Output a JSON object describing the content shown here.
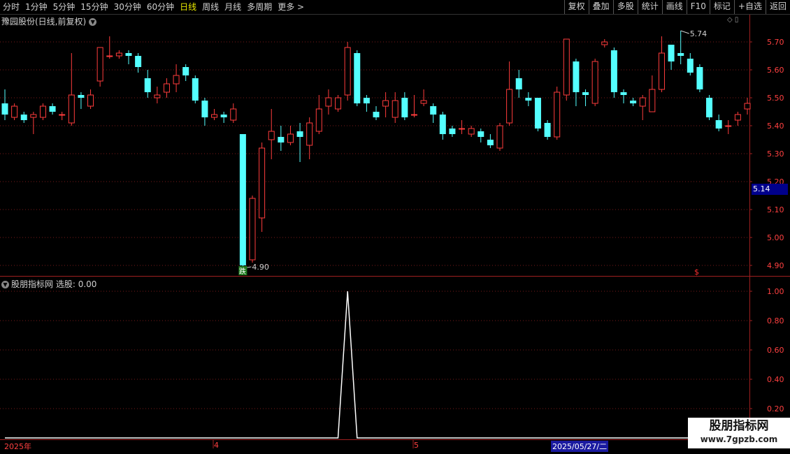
{
  "toolbar": {
    "period_tabs": [
      "分时",
      "1分钟",
      "5分钟",
      "15分钟",
      "30分钟",
      "60分钟",
      "日线",
      "周线",
      "月线",
      "多周期",
      "更多 >"
    ],
    "active_tab": "日线",
    "tools": [
      "复权",
      "叠加",
      "多股",
      "统计",
      "画线",
      "F10",
      "标记",
      "+自选",
      "返回"
    ]
  },
  "main_chart": {
    "title": "豫园股份(日线,前复权)",
    "current_price": "5.14",
    "price_ticks": [
      "5.70",
      "5.60",
      "5.50",
      "5.40",
      "5.30",
      "5.20",
      "5.10",
      "5.00",
      "4.90"
    ],
    "high_label": "5.74",
    "low_label": "4.90",
    "drop_marker": "跌",
    "s_marker": "$",
    "colors": {
      "up": "#ff3c3c",
      "down": "#54ffff",
      "grid": "#7a1a1a",
      "axis": "#a02020"
    }
  },
  "indicator": {
    "title": "股朋指标网",
    "value_label": "选股: 0.00",
    "ticks": [
      "1.00",
      "0.80",
      "0.60",
      "0.40",
      "0.20"
    ]
  },
  "date_axis": {
    "labels": [
      "2025年",
      "4",
      "5"
    ],
    "selected": "2025/05/27/二"
  },
  "watermark": {
    "title": "股朋指标网",
    "url": "www.7gpzb.com"
  },
  "chart_data": {
    "type": "candlestick",
    "ylim": [
      4.87,
      5.76
    ],
    "candles": [
      [
        5.48,
        5.44,
        5.53,
        5.42
      ],
      [
        5.43,
        5.47,
        5.48,
        5.42
      ],
      [
        5.44,
        5.42,
        5.45,
        5.41
      ],
      [
        5.43,
        5.44,
        5.45,
        5.37
      ],
      [
        5.43,
        5.47,
        5.48,
        5.42
      ],
      [
        5.47,
        5.45,
        5.48,
        5.44
      ],
      [
        5.44,
        5.44,
        5.45,
        5.42
      ],
      [
        5.41,
        5.51,
        5.66,
        5.4
      ],
      [
        5.51,
        5.5,
        5.52,
        5.46
      ],
      [
        5.47,
        5.51,
        5.53,
        5.46
      ],
      [
        5.56,
        5.68,
        5.68,
        5.54
      ],
      [
        5.65,
        5.65,
        5.72,
        5.64
      ],
      [
        5.65,
        5.66,
        5.67,
        5.64
      ],
      [
        5.66,
        5.65,
        5.67,
        5.62
      ],
      [
        5.65,
        5.61,
        5.66,
        5.59
      ],
      [
        5.57,
        5.52,
        5.6,
        5.5
      ],
      [
        5.5,
        5.51,
        5.54,
        5.48
      ],
      [
        5.52,
        5.55,
        5.57,
        5.5
      ],
      [
        5.55,
        5.58,
        5.62,
        5.52
      ],
      [
        5.61,
        5.58,
        5.62,
        5.56
      ],
      [
        5.57,
        5.49,
        5.58,
        5.48
      ],
      [
        5.49,
        5.43,
        5.5,
        5.4
      ],
      [
        5.43,
        5.44,
        5.46,
        5.42
      ],
      [
        5.44,
        5.43,
        5.45,
        5.41
      ],
      [
        5.42,
        5.46,
        5.48,
        5.41
      ],
      [
        5.37,
        4.9,
        5.37,
        4.89
      ],
      [
        4.92,
        5.14,
        5.15,
        4.91
      ],
      [
        5.07,
        5.32,
        5.34,
        5.02
      ],
      [
        5.35,
        5.38,
        5.46,
        5.28
      ],
      [
        5.36,
        5.34,
        5.4,
        5.31
      ],
      [
        5.34,
        5.37,
        5.4,
        5.33
      ],
      [
        5.38,
        5.36,
        5.41,
        5.27
      ],
      [
        5.33,
        5.41,
        5.43,
        5.28
      ],
      [
        5.38,
        5.46,
        5.51,
        5.37
      ],
      [
        5.47,
        5.5,
        5.53,
        5.44
      ],
      [
        5.46,
        5.5,
        5.51,
        5.45
      ],
      [
        5.51,
        5.68,
        5.7,
        5.49
      ],
      [
        5.66,
        5.48,
        5.67,
        5.47
      ],
      [
        5.5,
        5.48,
        5.51,
        5.45
      ],
      [
        5.45,
        5.43,
        5.47,
        5.42
      ],
      [
        5.47,
        5.49,
        5.52,
        5.43
      ],
      [
        5.43,
        5.49,
        5.52,
        5.41
      ],
      [
        5.5,
        5.43,
        5.52,
        5.42
      ],
      [
        5.44,
        5.44,
        5.51,
        5.43
      ],
      [
        5.48,
        5.49,
        5.53,
        5.47
      ],
      [
        5.47,
        5.44,
        5.48,
        5.41
      ],
      [
        5.44,
        5.37,
        5.45,
        5.35
      ],
      [
        5.39,
        5.37,
        5.4,
        5.36
      ],
      [
        5.39,
        5.39,
        5.42,
        5.37
      ],
      [
        5.37,
        5.39,
        5.4,
        5.36
      ],
      [
        5.38,
        5.36,
        5.39,
        5.34
      ],
      [
        5.35,
        5.33,
        5.37,
        5.32
      ],
      [
        5.32,
        5.4,
        5.41,
        5.31
      ],
      [
        5.41,
        5.53,
        5.63,
        5.4
      ],
      [
        5.57,
        5.53,
        5.6,
        5.5
      ],
      [
        5.5,
        5.49,
        5.52,
        5.47
      ],
      [
        5.5,
        5.39,
        5.5,
        5.38
      ],
      [
        5.41,
        5.36,
        5.42,
        5.35
      ],
      [
        5.36,
        5.52,
        5.54,
        5.35
      ],
      [
        5.51,
        5.71,
        5.71,
        5.49
      ],
      [
        5.63,
        5.52,
        5.64,
        5.47
      ],
      [
        5.52,
        5.51,
        5.53,
        5.47
      ],
      [
        5.48,
        5.63,
        5.64,
        5.47
      ],
      [
        5.69,
        5.7,
        5.71,
        5.68
      ],
      [
        5.67,
        5.52,
        5.68,
        5.5
      ],
      [
        5.52,
        5.51,
        5.53,
        5.48
      ],
      [
        5.49,
        5.48,
        5.5,
        5.47
      ],
      [
        5.47,
        5.5,
        5.51,
        5.42
      ],
      [
        5.45,
        5.53,
        5.58,
        5.45
      ],
      [
        5.53,
        5.66,
        5.72,
        5.52
      ],
      [
        5.69,
        5.63,
        5.69,
        5.6
      ],
      [
        5.66,
        5.65,
        5.74,
        5.62
      ],
      [
        5.64,
        5.59,
        5.66,
        5.58
      ],
      [
        5.61,
        5.53,
        5.62,
        5.52
      ],
      [
        5.5,
        5.43,
        5.51,
        5.42
      ],
      [
        5.42,
        5.39,
        5.44,
        5.38
      ],
      [
        5.4,
        5.4,
        5.42,
        5.37
      ],
      [
        5.42,
        5.44,
        5.45,
        5.4
      ],
      [
        5.46,
        5.48,
        5.5,
        5.44
      ]
    ],
    "indicator_series": {
      "name": "选股",
      "peak_index": 36,
      "peak_value": 1.0
    }
  }
}
